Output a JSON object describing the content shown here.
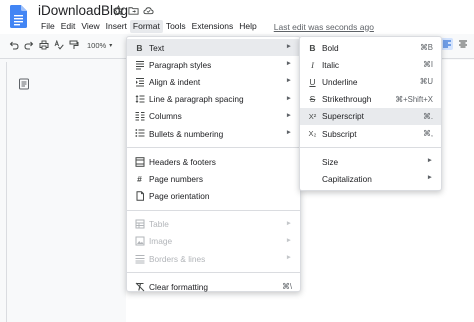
{
  "header": {
    "title": "iDownloadBlog",
    "last_edit": "Last edit was seconds ago"
  },
  "menubar": {
    "items": [
      "File",
      "Edit",
      "View",
      "Insert",
      "Format",
      "Tools",
      "Extensions",
      "Help"
    ],
    "active": "Format"
  },
  "toolbar": {
    "zoom": "100%",
    "zoom_caret": "▾"
  },
  "format_menu": {
    "items": [
      {
        "label": "Text",
        "icon": "bold-b-icon",
        "glyph": "B",
        "submenu": true
      },
      {
        "label": "Paragraph styles",
        "icon": "paragraph-styles-icon",
        "submenu": true
      },
      {
        "label": "Align & indent",
        "icon": "align-indent-icon",
        "submenu": true
      },
      {
        "label": "Line & paragraph spacing",
        "icon": "line-spacing-icon",
        "submenu": true
      },
      {
        "label": "Columns",
        "icon": "columns-icon",
        "submenu": true
      },
      {
        "label": "Bullets & numbering",
        "icon": "bullets-icon",
        "submenu": true
      },
      {
        "label": "Headers & footers",
        "icon": "headers-footers-icon"
      },
      {
        "label": "Page numbers",
        "icon": "page-numbers-icon",
        "glyph": "#"
      },
      {
        "label": "Page orientation",
        "icon": "page-orientation-icon"
      },
      {
        "label": "Table",
        "icon": "table-icon",
        "submenu": true,
        "disabled": true
      },
      {
        "label": "Image",
        "icon": "image-icon",
        "submenu": true,
        "disabled": true
      },
      {
        "label": "Borders & lines",
        "icon": "borders-lines-icon",
        "submenu": true,
        "disabled": true
      },
      {
        "label": "Clear formatting",
        "icon": "clear-formatting-icon",
        "shortcut": "⌘\\"
      }
    ],
    "arrow": "►"
  },
  "text_menu": {
    "items": [
      {
        "label": "Bold",
        "glyph": "B",
        "shortcut": "⌘B"
      },
      {
        "label": "Italic",
        "glyph": "I",
        "shortcut": "⌘I"
      },
      {
        "label": "Underline",
        "glyph": "U",
        "shortcut": "⌘U"
      },
      {
        "label": "Strikethrough",
        "glyph": "S",
        "shortcut": "⌘+Shift+X"
      },
      {
        "label": "Superscript",
        "glyph": "X²",
        "shortcut": "⌘."
      },
      {
        "label": "Subscript",
        "glyph": "X₂",
        "shortcut": "⌘,"
      },
      {
        "label": "Size",
        "submenu": true
      },
      {
        "label": "Capitalization",
        "submenu": true
      }
    ],
    "hovered": "Superscript"
  },
  "colors": {
    "docs_blue": "#4285f4",
    "hover_gray": "#e8eaed",
    "disabled_text": "#b2b5b9",
    "active_align": "#d3e3fd"
  }
}
